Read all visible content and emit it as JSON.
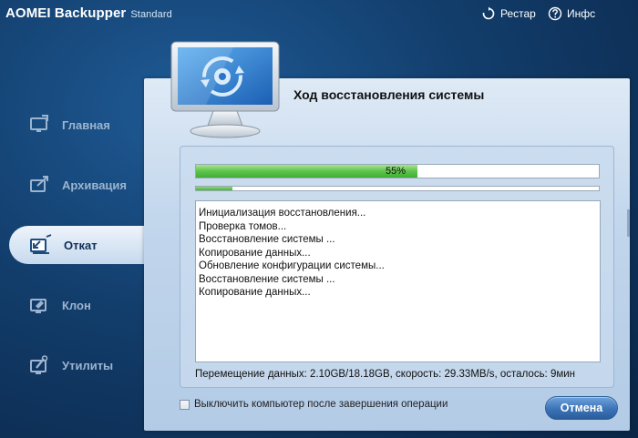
{
  "window": {
    "title": "AOMEI Backupper",
    "edition": "Standard"
  },
  "titlebar": {
    "restart_label": "Рестар",
    "info_label": "Инфс",
    "restart_icon": "refresh-icon",
    "info_icon": "help-icon"
  },
  "sidebar": {
    "items": [
      {
        "label": "Главная",
        "icon": "home-monitor-icon",
        "active": false
      },
      {
        "label": "Архивация",
        "icon": "backup-icon",
        "active": false
      },
      {
        "label": "Откат",
        "icon": "restore-icon",
        "active": true
      },
      {
        "label": "Клон",
        "icon": "clone-icon",
        "active": false
      },
      {
        "label": "Утилиты",
        "icon": "tools-icon",
        "active": false
      }
    ]
  },
  "main": {
    "title": "Ход восстановления системы",
    "progress": {
      "overall_percent": 55,
      "overall_label": "55%",
      "current_step_percent": 9
    },
    "log": [
      "Инициализация восстановления...",
      "Проверка томов...",
      "Восстановление системы ...",
      "Копирование данных...",
      "Обновление конфигурации системы...",
      "Восстановление системы ...",
      "Копирование данных..."
    ],
    "status": "Перемещение данных: 2.10GB/18.18GB, скорость: 29.33MB/s, осталось: 9мин",
    "shutdown_label": "Выключить компьютер после завершения операции",
    "shutdown_checked": false,
    "cancel_label": "Отмена"
  },
  "colors": {
    "accent": "#3c73b7",
    "progress": "#5ec44a",
    "background": "#123d6b"
  }
}
